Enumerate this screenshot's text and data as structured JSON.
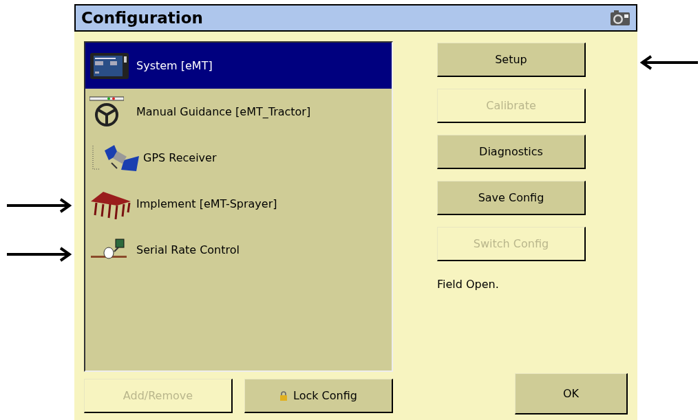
{
  "window": {
    "title": "Configuration"
  },
  "tree": {
    "items": [
      {
        "label": "System [eMT]",
        "kind": "display",
        "selected": true
      },
      {
        "label": "Manual Guidance [eMT_Tractor]",
        "kind": "steering",
        "selected": false,
        "children": [
          {
            "label": "GPS Receiver",
            "kind": "satellite",
            "selected": false
          }
        ]
      },
      {
        "label": "Implement [eMT-Sprayer]",
        "kind": "implement",
        "selected": false
      },
      {
        "label": "Serial Rate Control",
        "kind": "rate_control",
        "selected": false
      }
    ]
  },
  "side_buttons": [
    {
      "label": "Setup",
      "disabled": false
    },
    {
      "label": "Calibrate",
      "disabled": true
    },
    {
      "label": "Diagnostics",
      "disabled": false
    },
    {
      "label": "Save Config",
      "disabled": false
    },
    {
      "label": "Switch Config",
      "disabled": true
    }
  ],
  "status": "Field Open.",
  "bottom_buttons": [
    {
      "label": "Add/Remove",
      "disabled": true
    },
    {
      "label": "Lock Config",
      "disabled": false,
      "kind": "locking"
    }
  ],
  "ok_button": {
    "label": "OK"
  }
}
